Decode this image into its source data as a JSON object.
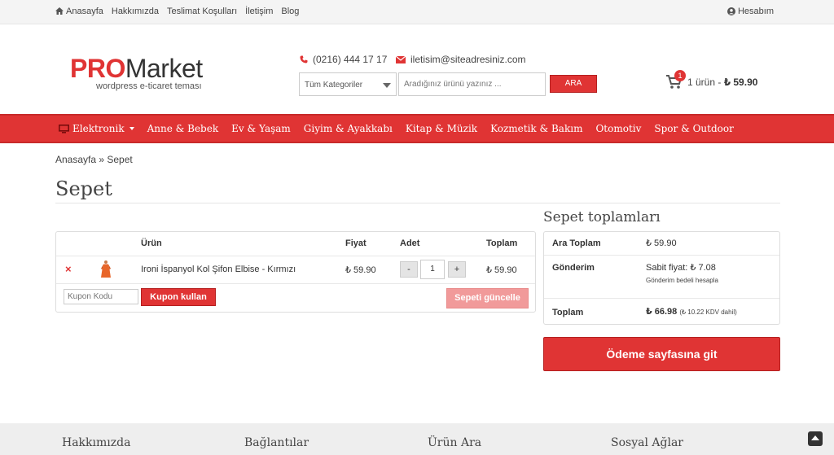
{
  "topbar": {
    "nav": [
      "Anasayfa",
      "Hakkımızda",
      "Teslimat Koşulları",
      "İletişim",
      "Blog"
    ],
    "account": "Hesabım"
  },
  "header": {
    "logo_pro": "PRO",
    "logo_market": "Market",
    "logo_sub": "wordpress e-ticaret teması",
    "phone": "(0216) 444 17 17",
    "email": "iletisim@siteadresiniz.com",
    "category_select": "Tüm Kategoriler",
    "search_placeholder": "Aradığınız ürünü yazınız ...",
    "search_button": "ARA",
    "cart_count": "1",
    "cart_text": "1 ürün - ",
    "cart_total": "₺ 59.90"
  },
  "mainnav": [
    "Elektronik",
    "Anne & Bebek",
    "Ev & Yaşam",
    "Giyim & Ayakkabı",
    "Kitap & Müzik",
    "Kozmetik & Bakım",
    "Otomotiv",
    "Spor & Outdoor"
  ],
  "breadcrumb": "Anasayfa » Sepet",
  "page_title": "Sepet",
  "cart": {
    "headers": {
      "product": "Ürün",
      "price": "Fiyat",
      "qty": "Adet",
      "total": "Toplam"
    },
    "row": {
      "remove": "×",
      "name": "Ironi İspanyol Kol Şifon Elbise - Kırmızı",
      "price": "₺ 59.90",
      "qty": "1",
      "minus": "-",
      "plus": "+",
      "total": "₺ 59.90"
    },
    "coupon_placeholder": "Kupon Kodu",
    "coupon_button": "Kupon kullan",
    "update_button": "Sepeti güncelle"
  },
  "totals": {
    "title": "Sepet toplamları",
    "subtotal_label": "Ara Toplam",
    "subtotal_value": "₺ 59.90",
    "shipping_label": "Gönderim",
    "shipping_value": "Sabit fiyat: ₺ 7.08",
    "shipping_calc": "Gönderim bedeli hesapla",
    "total_label": "Toplam",
    "total_value": "₺ 66.98",
    "total_tax": "(₺ 10.22 KDV dahil)",
    "checkout_button": "Ödeme sayfasına git"
  },
  "footer": [
    "Hakkımızda",
    "Bağlantılar",
    "Ürün Ara",
    "Sosyal Ağlar"
  ],
  "colors": {
    "accent": "#e03434"
  }
}
